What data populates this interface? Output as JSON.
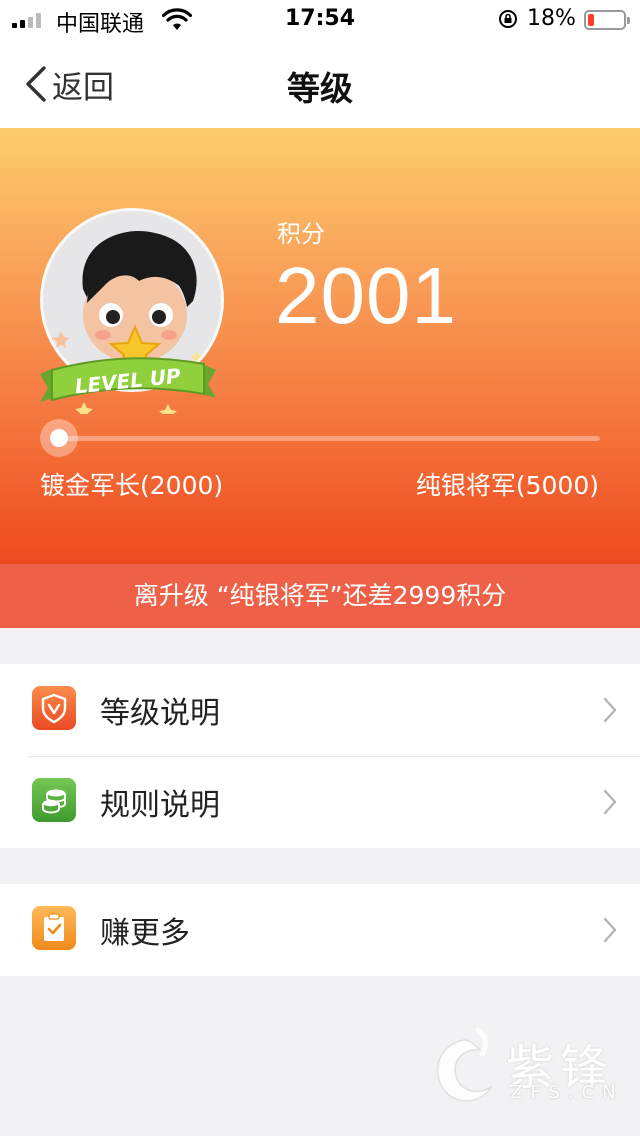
{
  "status_bar": {
    "carrier": "中国联通",
    "time": "17:54",
    "battery_percent": "18%",
    "battery_level": 0.18
  },
  "nav": {
    "back_label": "返回",
    "title": "等级"
  },
  "hero": {
    "badge_text": "LEVEL UP",
    "points_label": "积分",
    "points_value": "2001",
    "progress_fraction": 0.0003,
    "level_current": "镀金军长(2000)",
    "level_next": "纯银将军(5000)"
  },
  "upgrade_banner": "离升级 “纯银将军”还差2999积分",
  "menu": {
    "group1": [
      {
        "label": "等级说明",
        "icon": "shield-v-icon",
        "color": "#ef5a2c"
      },
      {
        "label": "规则说明",
        "icon": "coins-icon",
        "color": "#4fae3a"
      }
    ],
    "group2": [
      {
        "label": "赚更多",
        "icon": "clipboard-check-icon",
        "color": "#f59a2a"
      }
    ]
  },
  "watermark": {
    "text": "紫锋",
    "sub": "ZFS.CN"
  },
  "colors": {
    "hero_top": "#fccd6c",
    "hero_bottom": "#ee4a20",
    "banner": "#ee6148"
  }
}
